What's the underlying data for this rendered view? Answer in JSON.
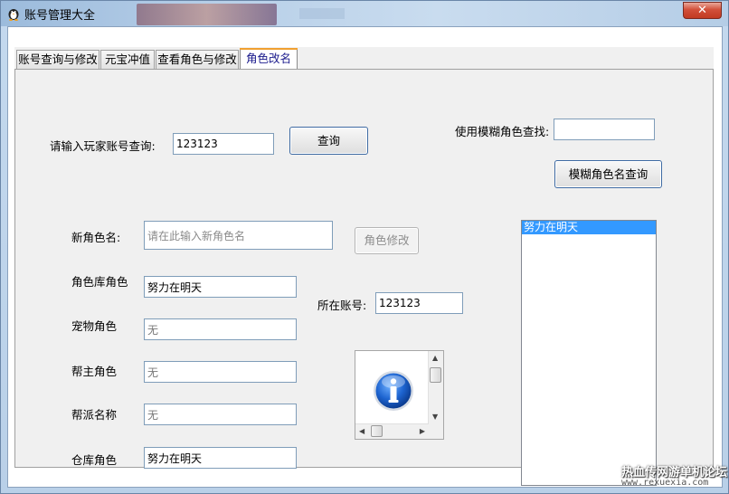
{
  "window": {
    "title": "账号管理大全",
    "close_symbol": "✕",
    "icon": "app-penguin-icon"
  },
  "tabs": [
    {
      "label": "账号查询与修改",
      "active": false
    },
    {
      "label": "元宝冲值",
      "active": false
    },
    {
      "label": "查看角色与修改",
      "active": false
    },
    {
      "label": "角色改名",
      "active": true
    }
  ],
  "query": {
    "label": "请输入玩家账号查询:",
    "account_value": "123123",
    "button": "查询"
  },
  "fuzzy": {
    "label": "使用模糊角色查找:",
    "value": "",
    "button": "模糊角色名查询"
  },
  "rename": {
    "new_name_label": "新角色名:",
    "new_name_placeholder": "请在此输入新角色名",
    "modify_button": "角色修改"
  },
  "fields": {
    "role_lib_label": "角色库角色",
    "role_lib_value": "努力在明天",
    "pet_label": "宠物角色",
    "pet_value": "无",
    "leader_label": "帮主角色",
    "leader_value": "无",
    "guild_label": "帮派名称",
    "guild_value": "无",
    "warehouse_label": "仓库角色",
    "warehouse_value": "努力在明天",
    "account_label": "所在账号:",
    "account_value": "123123"
  },
  "results": {
    "items": [
      "努力在明天"
    ],
    "selected_index": 0
  },
  "info_icon": "info-icon",
  "watermark": {
    "text": "热血传网游单机论坛",
    "url": "www.rexuexia.com"
  }
}
